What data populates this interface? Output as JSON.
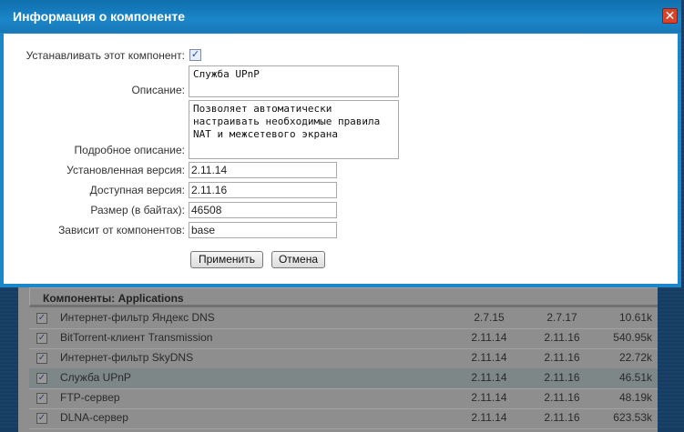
{
  "dialog": {
    "title": "Информация о компоненте",
    "close": "✕",
    "install_label": "Устанавливать этот компонент:",
    "install_checked": true,
    "description_label": "Описание:",
    "description": "Служба UPnP",
    "detailed_label": "Подробное описание:",
    "detailed": "Позволяет автоматически настраивать необходимые правила NAT и межсетевого экрана",
    "installed_label": "Установленная версия:",
    "installed": "2.11.14",
    "available_label": "Доступная версия:",
    "available": "2.11.16",
    "size_label": "Размер (в байтах):",
    "size": "46508",
    "depends_label": "Зависит от компонентов:",
    "depends": "base",
    "apply": "Применить",
    "cancel": "Отмена"
  },
  "table": {
    "title": "Компоненты: Applications",
    "check": "✓",
    "rows": [
      {
        "name": "Интернет-фильтр Яндекс DNS",
        "v1": "2.7.15",
        "v2": "2.7.17",
        "size": "10.61k"
      },
      {
        "name": "BitTorrent-клиент Transmission",
        "v1": "2.11.14",
        "v2": "2.11.16",
        "size": "540.95k"
      },
      {
        "name": "Интернет-фильтр SkyDNS",
        "v1": "2.11.14",
        "v2": "2.11.16",
        "size": "22.72k"
      },
      {
        "name": "Служба UPnP",
        "v1": "2.11.14",
        "v2": "2.11.16",
        "size": "46.51k"
      },
      {
        "name": "FTP-сервер",
        "v1": "2.11.14",
        "v2": "2.11.16",
        "size": "48.19k"
      },
      {
        "name": "DLNA-сервер",
        "v1": "2.11.14",
        "v2": "2.11.16",
        "size": "623.53k"
      }
    ]
  }
}
